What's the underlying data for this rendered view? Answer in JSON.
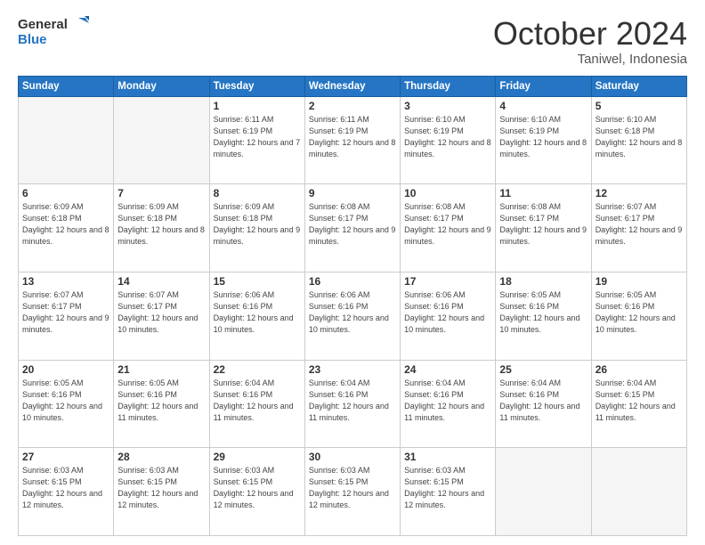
{
  "header": {
    "logo_line1": "General",
    "logo_line2": "Blue",
    "month": "October 2024",
    "location": "Taniwel, Indonesia"
  },
  "days_of_week": [
    "Sunday",
    "Monday",
    "Tuesday",
    "Wednesday",
    "Thursday",
    "Friday",
    "Saturday"
  ],
  "weeks": [
    [
      {
        "day": "",
        "info": ""
      },
      {
        "day": "",
        "info": ""
      },
      {
        "day": "1",
        "info": "Sunrise: 6:11 AM\nSunset: 6:19 PM\nDaylight: 12 hours and 7 minutes."
      },
      {
        "day": "2",
        "info": "Sunrise: 6:11 AM\nSunset: 6:19 PM\nDaylight: 12 hours and 8 minutes."
      },
      {
        "day": "3",
        "info": "Sunrise: 6:10 AM\nSunset: 6:19 PM\nDaylight: 12 hours and 8 minutes."
      },
      {
        "day": "4",
        "info": "Sunrise: 6:10 AM\nSunset: 6:19 PM\nDaylight: 12 hours and 8 minutes."
      },
      {
        "day": "5",
        "info": "Sunrise: 6:10 AM\nSunset: 6:18 PM\nDaylight: 12 hours and 8 minutes."
      }
    ],
    [
      {
        "day": "6",
        "info": "Sunrise: 6:09 AM\nSunset: 6:18 PM\nDaylight: 12 hours and 8 minutes."
      },
      {
        "day": "7",
        "info": "Sunrise: 6:09 AM\nSunset: 6:18 PM\nDaylight: 12 hours and 8 minutes."
      },
      {
        "day": "8",
        "info": "Sunrise: 6:09 AM\nSunset: 6:18 PM\nDaylight: 12 hours and 9 minutes."
      },
      {
        "day": "9",
        "info": "Sunrise: 6:08 AM\nSunset: 6:17 PM\nDaylight: 12 hours and 9 minutes."
      },
      {
        "day": "10",
        "info": "Sunrise: 6:08 AM\nSunset: 6:17 PM\nDaylight: 12 hours and 9 minutes."
      },
      {
        "day": "11",
        "info": "Sunrise: 6:08 AM\nSunset: 6:17 PM\nDaylight: 12 hours and 9 minutes."
      },
      {
        "day": "12",
        "info": "Sunrise: 6:07 AM\nSunset: 6:17 PM\nDaylight: 12 hours and 9 minutes."
      }
    ],
    [
      {
        "day": "13",
        "info": "Sunrise: 6:07 AM\nSunset: 6:17 PM\nDaylight: 12 hours and 9 minutes."
      },
      {
        "day": "14",
        "info": "Sunrise: 6:07 AM\nSunset: 6:17 PM\nDaylight: 12 hours and 10 minutes."
      },
      {
        "day": "15",
        "info": "Sunrise: 6:06 AM\nSunset: 6:16 PM\nDaylight: 12 hours and 10 minutes."
      },
      {
        "day": "16",
        "info": "Sunrise: 6:06 AM\nSunset: 6:16 PM\nDaylight: 12 hours and 10 minutes."
      },
      {
        "day": "17",
        "info": "Sunrise: 6:06 AM\nSunset: 6:16 PM\nDaylight: 12 hours and 10 minutes."
      },
      {
        "day": "18",
        "info": "Sunrise: 6:05 AM\nSunset: 6:16 PM\nDaylight: 12 hours and 10 minutes."
      },
      {
        "day": "19",
        "info": "Sunrise: 6:05 AM\nSunset: 6:16 PM\nDaylight: 12 hours and 10 minutes."
      }
    ],
    [
      {
        "day": "20",
        "info": "Sunrise: 6:05 AM\nSunset: 6:16 PM\nDaylight: 12 hours and 10 minutes."
      },
      {
        "day": "21",
        "info": "Sunrise: 6:05 AM\nSunset: 6:16 PM\nDaylight: 12 hours and 11 minutes."
      },
      {
        "day": "22",
        "info": "Sunrise: 6:04 AM\nSunset: 6:16 PM\nDaylight: 12 hours and 11 minutes."
      },
      {
        "day": "23",
        "info": "Sunrise: 6:04 AM\nSunset: 6:16 PM\nDaylight: 12 hours and 11 minutes."
      },
      {
        "day": "24",
        "info": "Sunrise: 6:04 AM\nSunset: 6:16 PM\nDaylight: 12 hours and 11 minutes."
      },
      {
        "day": "25",
        "info": "Sunrise: 6:04 AM\nSunset: 6:16 PM\nDaylight: 12 hours and 11 minutes."
      },
      {
        "day": "26",
        "info": "Sunrise: 6:04 AM\nSunset: 6:15 PM\nDaylight: 12 hours and 11 minutes."
      }
    ],
    [
      {
        "day": "27",
        "info": "Sunrise: 6:03 AM\nSunset: 6:15 PM\nDaylight: 12 hours and 12 minutes."
      },
      {
        "day": "28",
        "info": "Sunrise: 6:03 AM\nSunset: 6:15 PM\nDaylight: 12 hours and 12 minutes."
      },
      {
        "day": "29",
        "info": "Sunrise: 6:03 AM\nSunset: 6:15 PM\nDaylight: 12 hours and 12 minutes."
      },
      {
        "day": "30",
        "info": "Sunrise: 6:03 AM\nSunset: 6:15 PM\nDaylight: 12 hours and 12 minutes."
      },
      {
        "day": "31",
        "info": "Sunrise: 6:03 AM\nSunset: 6:15 PM\nDaylight: 12 hours and 12 minutes."
      },
      {
        "day": "",
        "info": ""
      },
      {
        "day": "",
        "info": ""
      }
    ]
  ]
}
